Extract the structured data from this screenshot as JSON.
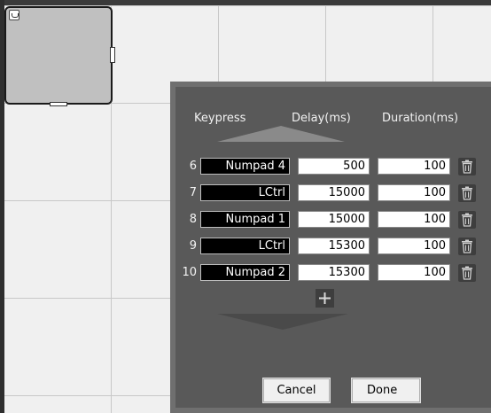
{
  "dialog": {
    "headers": {
      "keypress": "Keypress",
      "delay": "Delay(ms)",
      "duration": "Duration(ms)"
    },
    "rows": [
      {
        "index": "6",
        "key": "Numpad 4",
        "delay": "500",
        "duration": "100"
      },
      {
        "index": "7",
        "key": "LCtrl",
        "delay": "15000",
        "duration": "100"
      },
      {
        "index": "8",
        "key": "Numpad 1",
        "delay": "15000",
        "duration": "100"
      },
      {
        "index": "9",
        "key": "LCtrl",
        "delay": "15300",
        "duration": "100"
      },
      {
        "index": "10",
        "key": "Numpad 2",
        "delay": "15300",
        "duration": "100"
      }
    ],
    "buttons": {
      "cancel": "Cancel",
      "done": "Done"
    }
  },
  "icons": {
    "node": "node-type-icon",
    "delete": "trash-icon",
    "add": "plus-icon",
    "scroll_up": "scroll-up-arrow-icon",
    "scroll_down": "scroll-down-arrow-icon"
  },
  "colors": {
    "dialog_bg": "#595959",
    "key_field_bg": "#000000",
    "node_bg": "#c0c0c0",
    "canvas_bg": "#f0f0f0"
  }
}
